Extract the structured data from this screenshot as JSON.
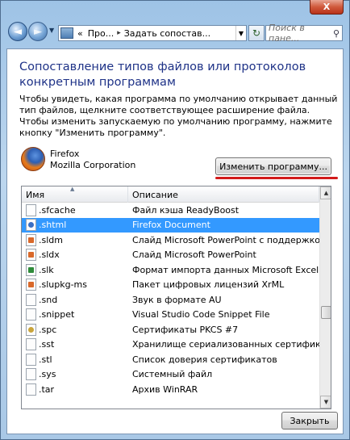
{
  "window": {
    "close_glyph": "X"
  },
  "navbar": {
    "back_glyph": "◄",
    "forward_glyph": "►",
    "breadcrumb": [
      "«",
      "Про...",
      "Задать сопостав..."
    ],
    "refresh_glyph": "↻",
    "search_placeholder": "Поиск в пане...",
    "search_icon": "⚲"
  },
  "content": {
    "heading": "Сопоставление типов файлов или протоколов конкретным программам",
    "description": "Чтобы увидеть, какая программа по умолчанию открывает данный тип файлов, щелкните соответствующее расширение файла. Чтобы изменить запускаемую по умолчанию программу, нажмите кнопку \"Изменить программу\".",
    "program_name": "Firefox",
    "program_company": "Mozilla Corporation",
    "change_button": "Изменить программу...",
    "close_button": "Закрыть"
  },
  "list": {
    "columns": [
      "Имя",
      "Описание"
    ],
    "rows": [
      {
        "name": ".sfcache",
        "desc": "Файл кэша ReadyBoost",
        "icon": "plain",
        "selected": false
      },
      {
        "name": ".shtml",
        "desc": "Firefox Document",
        "icon": "ff",
        "selected": true
      },
      {
        "name": ".sldm",
        "desc": "Слайд Microsoft PowerPoint с поддержкой макр",
        "icon": "orange",
        "selected": false
      },
      {
        "name": ".sldx",
        "desc": "Слайд Microsoft PowerPoint",
        "icon": "orange",
        "selected": false
      },
      {
        "name": ".slk",
        "desc": "Формат импорта данных Microsoft Excel SLK",
        "icon": "green",
        "selected": false
      },
      {
        "name": ".slupkg-ms",
        "desc": "Пакет цифровых лицензий XrML",
        "icon": "orange",
        "selected": false
      },
      {
        "name": ".snd",
        "desc": "Звук в формате AU",
        "icon": "plain",
        "selected": false
      },
      {
        "name": ".snippet",
        "desc": "Visual Studio Code Snippet File",
        "icon": "plain",
        "selected": false
      },
      {
        "name": ".spc",
        "desc": "Сертификаты PKCS #7",
        "icon": "cert",
        "selected": false
      },
      {
        "name": ".sst",
        "desc": "Хранилище сериализованных сертификатов",
        "icon": "plain",
        "selected": false
      },
      {
        "name": ".stl",
        "desc": "Список доверия сертификатов",
        "icon": "plain",
        "selected": false
      },
      {
        "name": ".sys",
        "desc": "Системный файл",
        "icon": "plain",
        "selected": false
      },
      {
        "name": ".tar",
        "desc": "Архив WinRAR",
        "icon": "plain",
        "selected": false
      }
    ]
  },
  "colors": {
    "heading": "#1e3287",
    "selection": "#3399ff",
    "annotation": "#d21a1a"
  }
}
